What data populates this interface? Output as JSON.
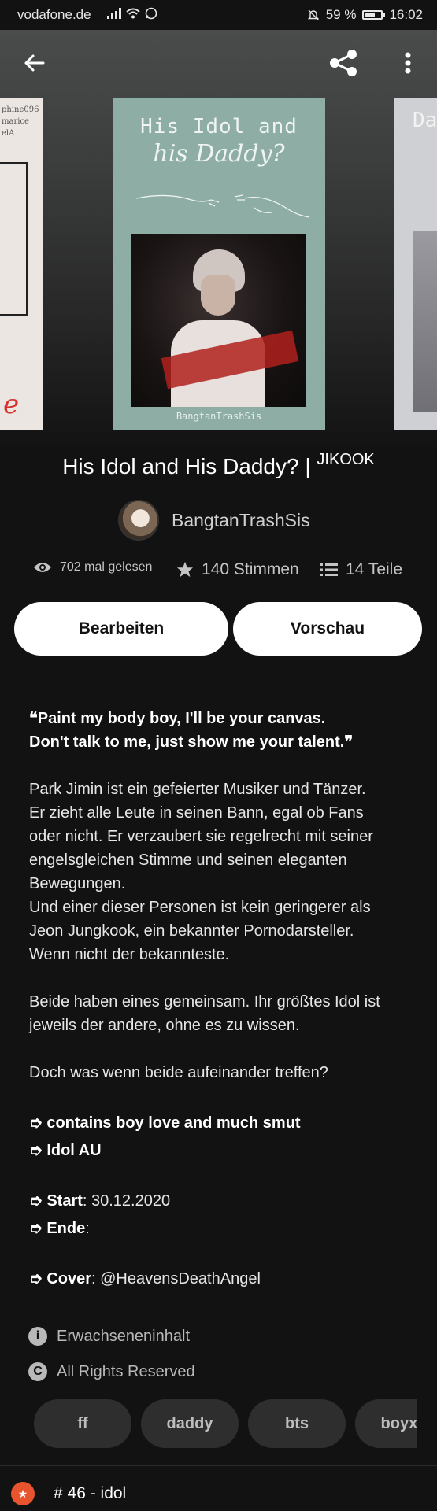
{
  "status_bar": {
    "carrier": "vodafone.de",
    "battery": "59 %",
    "time": "16:02"
  },
  "covers": {
    "left": {
      "text": [
        "phine096",
        "marice",
        "elA"
      ],
      "letter": "e"
    },
    "main": {
      "title_line1": "His Idol and",
      "title_line2": "his Daddy?",
      "author": "BangtanTrashSis"
    },
    "right": {
      "letter": "Da"
    }
  },
  "story": {
    "title": "His Idol and His Daddy? |",
    "title_sup": "JIKOOK",
    "author": "BangtanTrashSis",
    "reads": "702 mal gelesen",
    "votes": "140 Stimmen",
    "parts": "14 Teile"
  },
  "buttons": {
    "edit": "Bearbeiten",
    "preview": "Vorschau"
  },
  "description": {
    "quote1": "❝Paint my body boy, I'll be your canvas.",
    "quote2": "Don't talk to me, just show me your talent.❞",
    "p1": [
      "Park Jimin ist ein gefeierter Musiker und Tänzer.",
      "Er zieht alle Leute in seinen Bann, egal ob Fans",
      "oder nicht. Er verzaubert sie regelrecht mit seiner",
      "engelsgleichen Stimme und seinen eleganten",
      "Bewegungen.",
      "Und einer dieser Personen ist kein geringerer als",
      "Jeon Jungkook, ein bekannter Pornodarsteller.",
      "Wenn nicht der bekannteste."
    ],
    "p2": [
      "Beide haben eines gemeinsam. Ihr größtes Idol ist",
      "jeweils der andere, ohne es zu wissen."
    ],
    "p3": "Doch was wenn beide aufeinander treffen?",
    "bullet1": "➮ contains boy love and much smut",
    "bullet2": "➮ Idol AU",
    "start_label": "➮ Start",
    "start_value": ": 30.12.2020",
    "end_label": "➮ Ende",
    "end_value": ":",
    "cover_label": "➮ Cover",
    "cover_value": ": @HeavensDeathAngel"
  },
  "info": {
    "mature": "Erwachseneninhalt",
    "rights": "All Rights Reserved",
    "mature_icon": "i",
    "rights_icon": "C"
  },
  "tags": [
    "ff",
    "daddy",
    "bts",
    "boyxb"
  ],
  "ranking": {
    "text": "# 46 - idol"
  },
  "colors": {
    "background": "#121212",
    "cover_teal": "#8dada5",
    "rank_badge": "#e8542d"
  }
}
